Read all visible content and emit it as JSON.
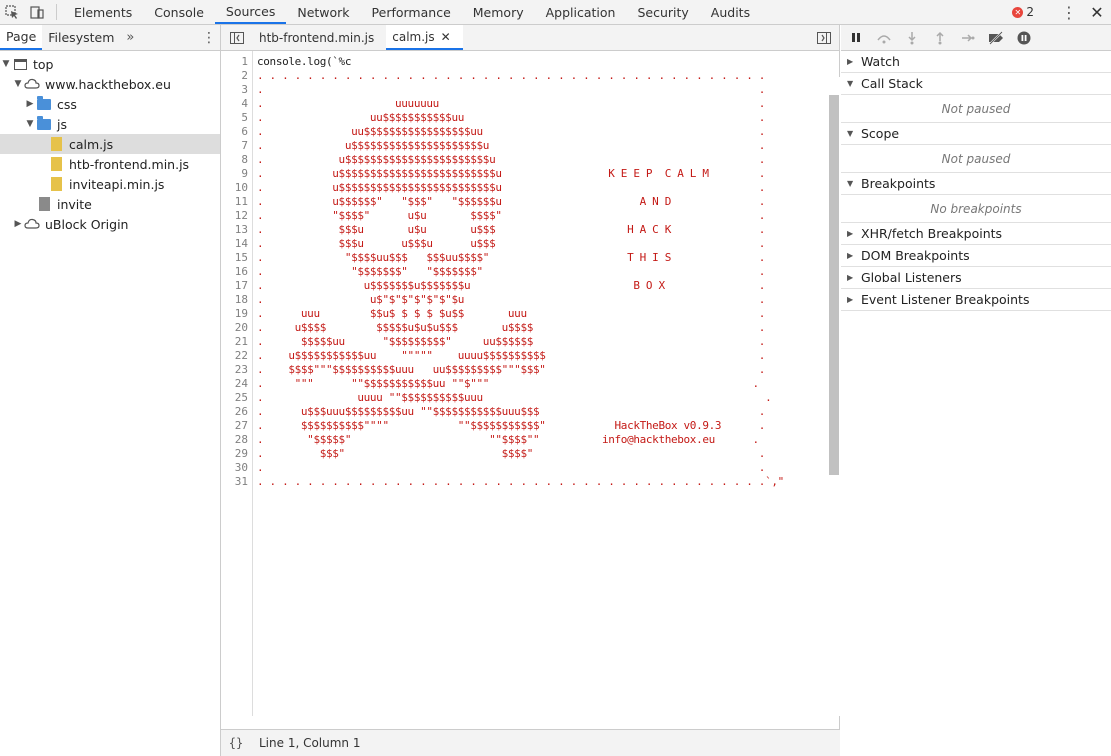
{
  "topbar": {
    "tabs": [
      "Elements",
      "Console",
      "Sources",
      "Network",
      "Performance",
      "Memory",
      "Application",
      "Security",
      "Audits"
    ],
    "active_tab": "Sources",
    "error_count": "2"
  },
  "navigator": {
    "tabs": [
      "Page",
      "Filesystem"
    ],
    "tree": {
      "top": "top",
      "domain": "www.hackthebox.eu",
      "css": "css",
      "js": "js",
      "files": [
        "calm.js",
        "htb-frontend.min.js",
        "inviteapi.min.js"
      ],
      "invite": "invite",
      "ublock": "uBlock Origin"
    }
  },
  "editor": {
    "tabs": [
      "htb-frontend.min.js",
      "calm.js"
    ],
    "line_numbers": [
      "1",
      "2",
      "3",
      "4",
      "5",
      "6",
      "7",
      "8",
      "9",
      "10",
      "11",
      "12",
      "13",
      "14",
      "15",
      "16",
      "17",
      "18",
      "19",
      "20",
      "21",
      "22",
      "23",
      "24",
      "25",
      "26",
      "27",
      "28",
      "29",
      "30",
      "31"
    ],
    "lines": [
      "console.log(`%c",
      ". . . . . . . . . . . . . . . . . . . . . . . . . . . . . . . . . . . . . . . . .",
      ".                                                                               .",
      ".                     uuuuuuu                                                   .",
      ".                 uu$$$$$$$$$$$uu                                               .",
      ".              uu$$$$$$$$$$$$$$$$$uu                                            .",
      ".             u$$$$$$$$$$$$$$$$$$$$$u                                           .",
      ".            u$$$$$$$$$$$$$$$$$$$$$$$u                                          .",
      ".           u$$$$$$$$$$$$$$$$$$$$$$$$$u                 K E E P  C A L M        .",
      ".           u$$$$$$$$$$$$$$$$$$$$$$$$$u                                         .",
      ".           u$$$$$$\"   \"$$$\"   \"$$$$$$u                      A N D              .",
      ".           \"$$$$\"      u$u       $$$$\"                                         .",
      ".            $$$u       u$u       u$$$                     H A C K              .",
      ".            $$$u      u$$$u      u$$$                                          .",
      ".             \"$$$$uu$$$   $$$uu$$$$\"                      T H I S              .",
      ".              \"$$$$$$$\"   \"$$$$$$$\"                                            .",
      ".                u$$$$$$$u$$$$$$$u                          B O X               .",
      ".                 u$\"$\"$\"$\"$\"$\"$u                                               .",
      ".      uuu        $$u$ $ $ $ $u$$       uuu                                     .",
      ".     u$$$$        $$$$$u$u$u$$$       u$$$$                                    .",
      ".      $$$$$uu      \"$$$$$$$$$\"     uu$$$$$$                                    .",
      ".    u$$$$$$$$$$$uu    \"\"\"\"\"    uuuu$$$$$$$$$$                                  .",
      ".    $$$$\"\"\"$$$$$$$$$$uuu   uu$$$$$$$$$\"\"\"$$$\"                                  .",
      ".     \"\"\"      \"\"$$$$$$$$$$$uu \"\"$\"\"\"                                          .",
      ".               uuuu \"\"$$$$$$$$$$uuu                                             .",
      ".      u$$$uuu$$$$$$$$$uu \"\"$$$$$$$$$$$uuu$$$                                   .",
      ".      $$$$$$$$$$\"\"\"\"           \"\"$$$$$$$$$$$\"           HackTheBox v0.9.3      .",
      ".       \"$$$$$\"                      \"\"$$$$\"\"          info@hackthebox.eu      .",
      ".         $$$\"                         $$$$\"                                    .",
      ".                                                                               .",
      ". . . . . . . . . . . . . . . . . . . . . . . . . . . . . . . . . . . . . . . . .`,\""
    ],
    "status": "Line 1, Column 1",
    "braces": "{}"
  },
  "debugger": {
    "sections": {
      "watch": "Watch",
      "call_stack": "Call Stack",
      "call_stack_msg": "Not paused",
      "scope": "Scope",
      "scope_msg": "Not paused",
      "breakpoints": "Breakpoints",
      "breakpoints_msg": "No breakpoints",
      "xhr": "XHR/fetch Breakpoints",
      "dom": "DOM Breakpoints",
      "global": "Global Listeners",
      "event": "Event Listener Breakpoints"
    }
  },
  "colors": {
    "accent": "#1a73e8",
    "code_red": "#c41a16",
    "error_red": "#e8453c"
  },
  "icons": [
    "inspect-icon",
    "device-icon",
    "error-icon",
    "kebab-icon",
    "close-icon",
    "chevron-right-double-icon",
    "frame-icon",
    "cloud-icon",
    "folder-icon",
    "file-icon",
    "pause-icon",
    "step-over-icon",
    "step-into-icon",
    "step-out-icon",
    "step-icon",
    "deactivate-breakpoints-icon",
    "pause-exceptions-icon"
  ]
}
